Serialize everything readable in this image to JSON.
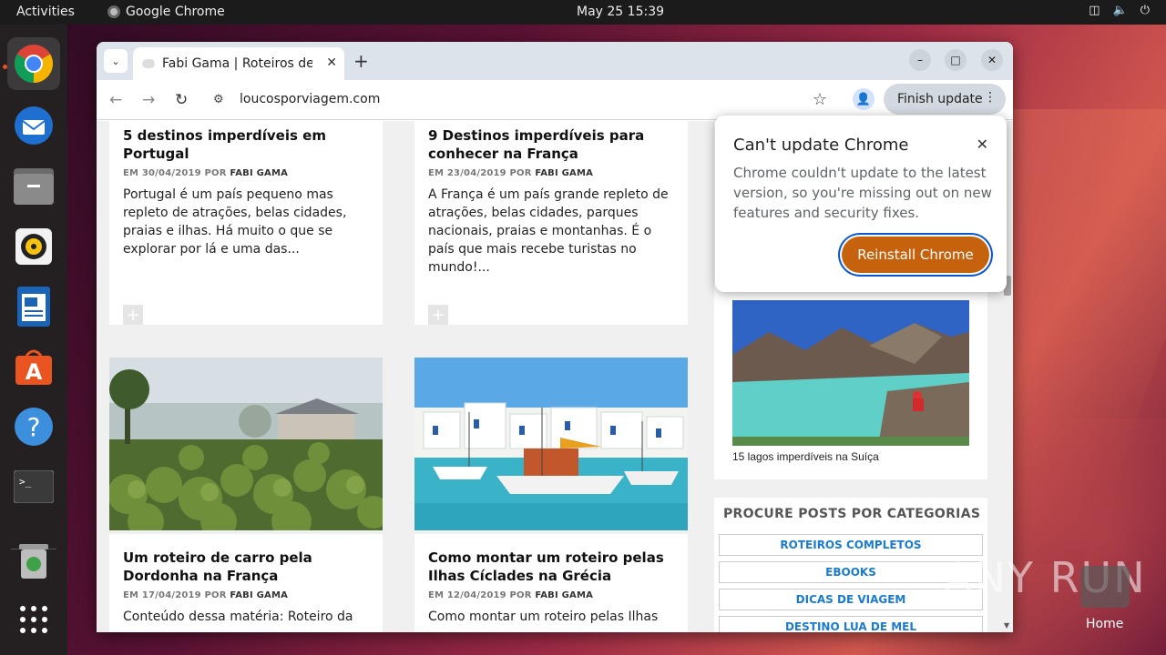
{
  "topbar": {
    "activities": "Activities",
    "app_name": "Google Chrome",
    "clock": "May 25  15:39"
  },
  "dock": {
    "items": [
      "chrome-icon",
      "thunderbird-icon",
      "files-icon",
      "rhythmbox-icon",
      "writer-icon",
      "app-center-icon",
      "help-icon",
      "terminal-icon",
      "trash-icon",
      "app-grid-icon"
    ]
  },
  "browser": {
    "tab_title": "Fabi Gama | Roteiros de V",
    "url": "loucosporviagem.com",
    "finish_update": "Finish update"
  },
  "articles": [
    {
      "title": "5 destinos imperdíveis em Portugal",
      "date": "EM 30/04/2019 POR",
      "author": "FABI GAMA",
      "excerpt": "Portugal é um país pequeno mas repleto de atrações, belas cidades, praias e ilhas. Há muito o que se explorar por lá e uma das..."
    },
    {
      "title": "9 Destinos imperdíveis para conhecer na França",
      "date": "EM 23/04/2019 POR",
      "author": "FABI GAMA",
      "excerpt": "A França é um país grande repleto de atrações, belas cidades, parques nacionais, praias e montanhas. É o país que mais recebe turistas no mundo!..."
    },
    {
      "title": "Um roteiro de carro pela Dordonha na França",
      "date": "EM 17/04/2019 POR",
      "author": "FABI GAMA",
      "excerpt": "Conteúdo dessa matéria: Roteiro da"
    },
    {
      "title": "Como montar um roteiro pelas Ilhas Cíclades na Grécia",
      "date": "EM 12/04/2019 POR",
      "author": "FABI GAMA",
      "excerpt": "Como montar um roteiro pelas Ilhas"
    }
  ],
  "sidebar": {
    "featured_caption": "15 lagos imperdíveis na Suíça",
    "categories_title": "PROCURE POSTS POR CATEGORIAS",
    "categories": [
      "ROTEIROS COMPLETOS",
      "EBOOKS",
      "DICAS DE VIAGEM",
      "DESTINO LUA DE MEL"
    ]
  },
  "popup": {
    "title": "Can't update Chrome",
    "body": "Chrome couldn't update to the latest version, so you're missing out on new features and security fixes.",
    "button": "Reinstall Chrome"
  },
  "desktop": {
    "watermark": "ANY RUN",
    "home_label": "Home"
  }
}
